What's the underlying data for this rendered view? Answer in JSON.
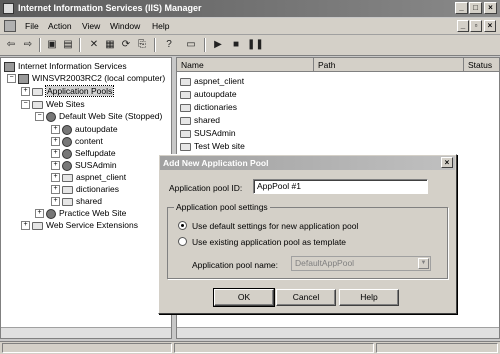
{
  "window": {
    "title": "Internet Information Services (IIS) Manager"
  },
  "menu": {
    "items": [
      "File",
      "Action",
      "View",
      "Window",
      "Help"
    ]
  },
  "tree": {
    "root": "Internet Information Services",
    "computer": "WINSVR2003RC2 (local computer)",
    "app_pools": "Application Pools",
    "web_sites": "Web Sites",
    "default_site": "Default Web Site (Stopped)",
    "children": [
      "autoupdate",
      "content",
      "Selfupdate",
      "SUSAdmin",
      "aspnet_client",
      "dictionaries",
      "shared"
    ],
    "practice_site": "Practice Web Site",
    "extensions": "Web Service Extensions"
  },
  "list": {
    "columns": [
      "Name",
      "Path",
      "Status"
    ],
    "rows": [
      "aspnet_client",
      "autoupdate",
      "dictionaries",
      "shared",
      "SUSAdmin",
      "Test Web site"
    ]
  },
  "dialog": {
    "title": "Add New Application Pool",
    "pool_id_label": "Application pool ID:",
    "pool_id_value": "AppPool #1",
    "group_title": "Application pool settings",
    "option_default": "Use default settings for new application pool",
    "option_existing": "Use existing application pool as template",
    "pool_name_label": "Application pool name:",
    "pool_name_value": "DefaultAppPool",
    "ok": "OK",
    "cancel": "Cancel",
    "help": "Help"
  },
  "icons": {
    "back": "back-arrow-icon",
    "forward": "forward-arrow-icon",
    "up": "up-folder-icon",
    "delete": "delete-icon",
    "properties": "properties-icon",
    "refresh": "refresh-icon",
    "export": "export-icon",
    "help": "help-icon",
    "computer": "computer-icon",
    "play": "play-icon",
    "stop": "stop-icon",
    "pause": "pause-icon"
  }
}
